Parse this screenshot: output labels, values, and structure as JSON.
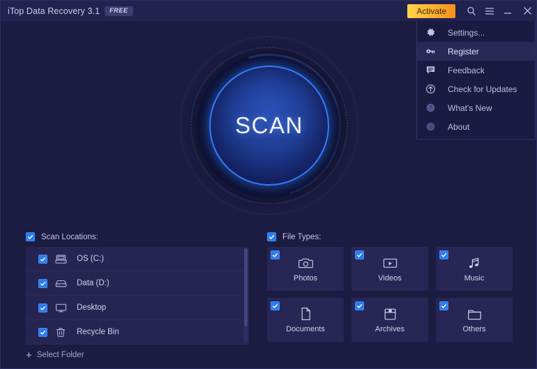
{
  "window": {
    "title": "iTop Data Recovery 3.1",
    "badge": "FREE",
    "bg_color": "#1c1c42",
    "titlebar_color": "#22224e"
  },
  "titlebar": {
    "activate_label": "Activate",
    "icons": [
      {
        "name": "search-icon"
      },
      {
        "name": "hamburger-menu-icon"
      },
      {
        "name": "minimize-icon"
      },
      {
        "name": "close-icon"
      }
    ]
  },
  "menu": {
    "accent_selected": "#2a2857",
    "items": [
      {
        "label": "Settings...",
        "icon": "gear-icon",
        "selected": false
      },
      {
        "label": "Register",
        "icon": "key-icon",
        "selected": true
      },
      {
        "label": "Feedback",
        "icon": "feedback-icon",
        "selected": false
      },
      {
        "label": "Check for Updates",
        "icon": "update-icon",
        "selected": false
      },
      {
        "label": "What's New",
        "icon": "question-circle-icon",
        "selected": false
      },
      {
        "label": "About",
        "icon": "info-circle-icon",
        "selected": false
      }
    ]
  },
  "scan": {
    "label": "SCAN",
    "accent_color": "#2f7dff"
  },
  "scan_locations": {
    "header": "Scan Locations:",
    "select_folder": "Select Folder",
    "items": [
      {
        "label": "OS (C:)",
        "icon": "hard-drive-icon",
        "checked": true
      },
      {
        "label": "Data (D:)",
        "icon": "disk-drive-icon",
        "checked": true
      },
      {
        "label": "Desktop",
        "icon": "monitor-icon",
        "checked": true
      },
      {
        "label": "Recycle Bin",
        "icon": "trash-icon",
        "checked": true
      }
    ]
  },
  "file_types": {
    "header": "File Types:",
    "items": [
      {
        "label": "Photos",
        "icon": "camera-icon",
        "checked": true
      },
      {
        "label": "Videos",
        "icon": "video-icon",
        "checked": true
      },
      {
        "label": "Music",
        "icon": "music-note-icon",
        "checked": true
      },
      {
        "label": "Documents",
        "icon": "document-icon",
        "checked": true
      },
      {
        "label": "Archives",
        "icon": "archive-box-icon",
        "checked": true
      },
      {
        "label": "Others",
        "icon": "folder-icon",
        "checked": true
      }
    ]
  }
}
